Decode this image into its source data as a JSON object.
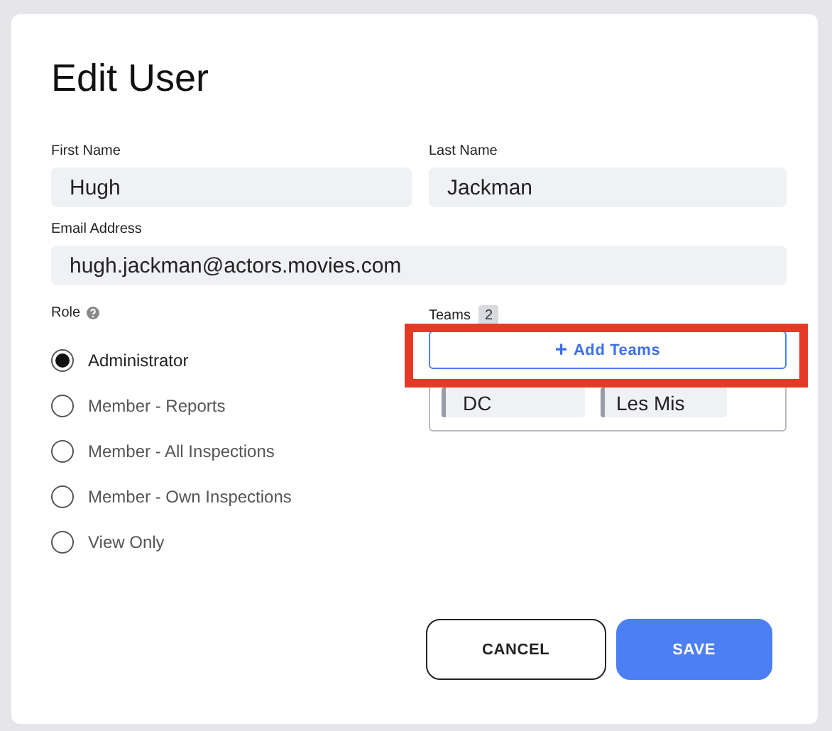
{
  "dialog": {
    "title": "Edit User"
  },
  "fields": [
    {
      "label": "First Name",
      "value": "Hugh"
    },
    {
      "label": "Last Name",
      "value": "Jackman"
    },
    {
      "label": "Email Address",
      "value": "hugh.jackman@actors.movies.com"
    }
  ],
  "role": {
    "label": "Role",
    "options": [
      {
        "label": "Administrator",
        "selected": true
      },
      {
        "label": "Member - Reports",
        "selected": false
      },
      {
        "label": "Member - All Inspections",
        "selected": false
      },
      {
        "label": "Member - Own Inspections",
        "selected": false
      },
      {
        "label": "View Only",
        "selected": false
      }
    ]
  },
  "teams": {
    "label": "Teams",
    "count": "2",
    "add_button": "Add Teams",
    "add_icon": "+",
    "highlighted": true,
    "items": [
      {
        "name": "DC"
      },
      {
        "name": "Les Mis"
      }
    ]
  },
  "buttons": [
    {
      "label": "CANCEL",
      "kind": "secondary"
    },
    {
      "label": "SAVE",
      "kind": "primary"
    }
  ]
}
